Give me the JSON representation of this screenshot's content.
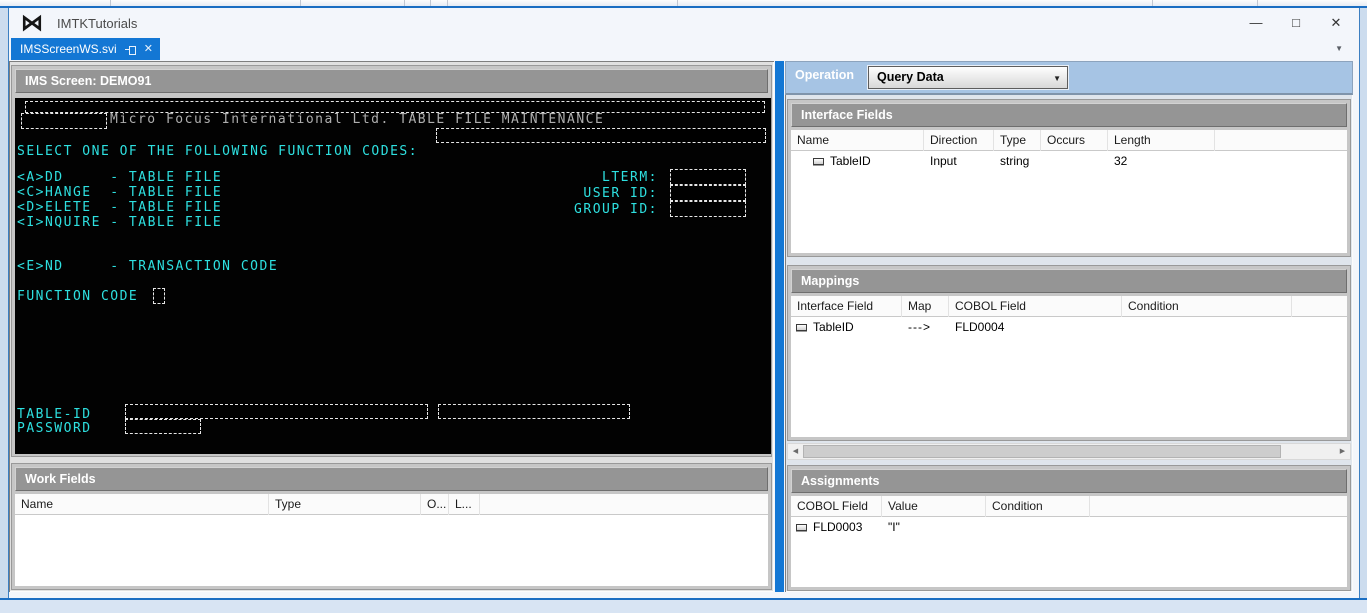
{
  "window": {
    "title": "IMTKTutorials",
    "tab": {
      "label": "IMSScreenWS.svi"
    }
  },
  "icons": {
    "vs_logo": "⋈",
    "minimize": "—",
    "maximize": "□",
    "close": "✕",
    "tab_close": "✕",
    "tab_overflow": "▼",
    "combo_arrow": "▼",
    "scroll_left": "◀",
    "scroll_right": "▶"
  },
  "colors": {
    "accent_blue": "#1377d4",
    "terminal_text": "#2ee0e0",
    "terminal_banner": "#aeaeae",
    "panel_header_gray": "#959595",
    "operation_bar_blue": "#a6c4e4"
  },
  "ims_screen": {
    "header": "IMS Screen: DEMO91",
    "terminal": {
      "banner": "Micro Focus International Ltd. TABLE FILE MAINTENANCE",
      "select_line": "SELECT ONE OF THE FOLLOWING FUNCTION CODES:",
      "menu": [
        "<A>DD     - TABLE FILE",
        "<C>HANGE  - TABLE FILE",
        "<D>ELETE  - TABLE FILE",
        "<I>NQUIRE - TABLE FILE"
      ],
      "end_line": "<E>ND     - TRANSACTION CODE",
      "labels_right": [
        "LTERM:",
        "USER ID:",
        "GROUP ID:"
      ],
      "function_code_label": "FUNCTION CODE",
      "table_id_label": "TABLE-ID",
      "password_label": "PASSWORD"
    }
  },
  "operation": {
    "label": "Operation",
    "value": "Query Data"
  },
  "interface_fields": {
    "title": "Interface Fields",
    "columns": [
      "Name",
      "Direction",
      "Type",
      "Occurs",
      "Length"
    ],
    "rows": [
      {
        "name": "TableID",
        "direction": "Input",
        "type": "string",
        "occurs": "",
        "length": "32"
      }
    ]
  },
  "mappings": {
    "title": "Mappings",
    "columns": [
      "Interface Field",
      "Map",
      "COBOL Field",
      "Condition"
    ],
    "rows": [
      {
        "interface_field": "TableID",
        "map": "--->",
        "cobol_field": "FLD0004",
        "condition": ""
      }
    ]
  },
  "assignments": {
    "title": "Assignments",
    "columns": [
      "COBOL Field",
      "Value",
      "Condition"
    ],
    "rows": [
      {
        "cobol_field": "FLD0003",
        "value": "\"I\"",
        "condition": ""
      }
    ]
  },
  "work_fields": {
    "title": "Work Fields",
    "columns": [
      "Name",
      "Type",
      "O...",
      "L..."
    ],
    "rows": []
  }
}
